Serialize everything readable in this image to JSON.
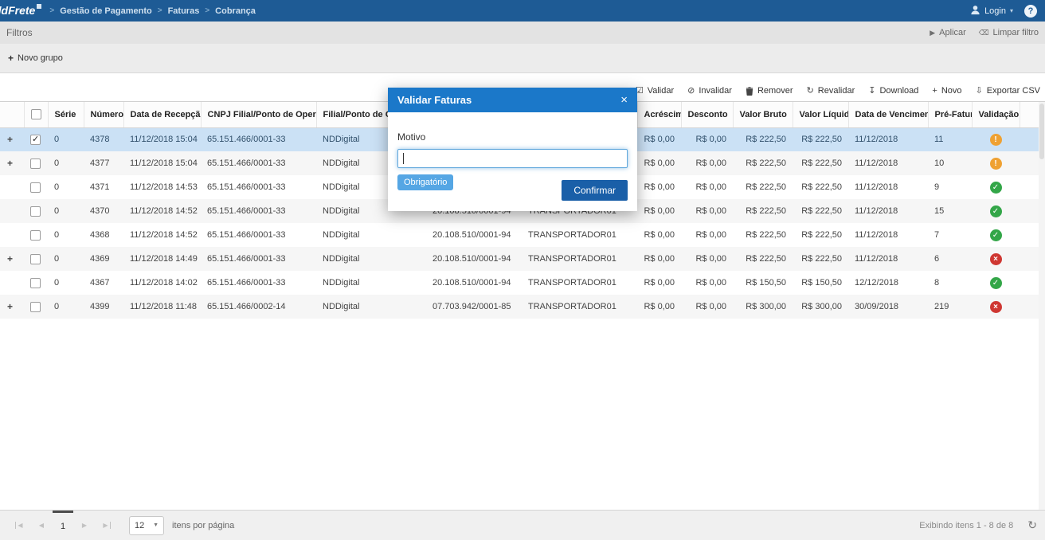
{
  "topbar": {
    "logo": "ddFrete",
    "breadcrumbs": [
      "Gestão de Pagamento",
      "Faturas",
      "Cobrança"
    ],
    "login_label": "Login",
    "help_label": "?"
  },
  "filters": {
    "title": "Filtros",
    "apply_label": "Aplicar",
    "clear_label": "Limpar filtro",
    "new_group_label": "Novo grupo"
  },
  "toolbar": {
    "validate_label": "Validar",
    "invalidate_label": "Invalidar",
    "remove_label": "Remover",
    "revalidate_label": "Revalidar",
    "download_label": "Download",
    "new_label": "Novo",
    "export_csv_label": "Exportar CSV"
  },
  "table": {
    "headers": {
      "serie": "Série",
      "numero": "Número",
      "recepcao": "Data de Recepção",
      "cnpj_filial": "CNPJ Filial/Ponto de Operação",
      "filial": "Filial/Ponto de Operação",
      "cnpj_transp": "",
      "transp": "",
      "acrescimo": "Acréscimo",
      "desconto": "Desconto",
      "bruto": "Valor Bruto",
      "liquido": "Valor Líquido",
      "vencimento": "Data de Vencimento",
      "prefatura": "Pré-Fatura",
      "validacao": "Validação"
    },
    "rows": [
      {
        "expand": true,
        "checked": true,
        "selected": true,
        "serie": "0",
        "numero": "4378",
        "recepcao": "11/12/2018 15:04",
        "cnpj_filial": "65.151.466/0001-33",
        "filial": "NDDigital",
        "cnpj_transp": "",
        "transp": "",
        "acrescimo": "R$ 0,00",
        "desconto": "R$ 0,00",
        "bruto": "R$ 222,50",
        "liquido": "R$ 222,50",
        "vencimento": "11/12/2018",
        "prefatura": "11",
        "validacao": "warning"
      },
      {
        "expand": true,
        "checked": false,
        "selected": false,
        "serie": "0",
        "numero": "4377",
        "recepcao": "11/12/2018 15:04",
        "cnpj_filial": "65.151.466/0001-33",
        "filial": "NDDigital",
        "cnpj_transp": "",
        "transp": "",
        "acrescimo": "R$ 0,00",
        "desconto": "R$ 0,00",
        "bruto": "R$ 222,50",
        "liquido": "R$ 222,50",
        "vencimento": "11/12/2018",
        "prefatura": "10",
        "validacao": "warning"
      },
      {
        "expand": false,
        "checked": false,
        "selected": false,
        "serie": "0",
        "numero": "4371",
        "recepcao": "11/12/2018 14:53",
        "cnpj_filial": "65.151.466/0001-33",
        "filial": "NDDigital",
        "cnpj_transp": "",
        "transp": "",
        "acrescimo": "R$ 0,00",
        "desconto": "R$ 0,00",
        "bruto": "R$ 222,50",
        "liquido": "R$ 222,50",
        "vencimento": "11/12/2018",
        "prefatura": "9",
        "validacao": "ok"
      },
      {
        "expand": false,
        "checked": false,
        "selected": false,
        "serie": "0",
        "numero": "4370",
        "recepcao": "11/12/2018 14:52",
        "cnpj_filial": "65.151.466/0001-33",
        "filial": "NDDigital",
        "cnpj_transp": "20.108.510/0001-94",
        "transp": "TRANSPORTADOR01",
        "acrescimo": "R$ 0,00",
        "desconto": "R$ 0,00",
        "bruto": "R$ 222,50",
        "liquido": "R$ 222,50",
        "vencimento": "11/12/2018",
        "prefatura": "15",
        "validacao": "ok"
      },
      {
        "expand": false,
        "checked": false,
        "selected": false,
        "serie": "0",
        "numero": "4368",
        "recepcao": "11/12/2018 14:52",
        "cnpj_filial": "65.151.466/0001-33",
        "filial": "NDDigital",
        "cnpj_transp": "20.108.510/0001-94",
        "transp": "TRANSPORTADOR01",
        "acrescimo": "R$ 0,00",
        "desconto": "R$ 0,00",
        "bruto": "R$ 222,50",
        "liquido": "R$ 222,50",
        "vencimento": "11/12/2018",
        "prefatura": "7",
        "validacao": "ok"
      },
      {
        "expand": true,
        "checked": false,
        "selected": false,
        "serie": "0",
        "numero": "4369",
        "recepcao": "11/12/2018 14:49",
        "cnpj_filial": "65.151.466/0001-33",
        "filial": "NDDigital",
        "cnpj_transp": "20.108.510/0001-94",
        "transp": "TRANSPORTADOR01",
        "acrescimo": "R$ 0,00",
        "desconto": "R$ 0,00",
        "bruto": "R$ 222,50",
        "liquido": "R$ 222,50",
        "vencimento": "11/12/2018",
        "prefatura": "6",
        "validacao": "error"
      },
      {
        "expand": false,
        "checked": false,
        "selected": false,
        "serie": "0",
        "numero": "4367",
        "recepcao": "11/12/2018 14:02",
        "cnpj_filial": "65.151.466/0001-33",
        "filial": "NDDigital",
        "cnpj_transp": "20.108.510/0001-94",
        "transp": "TRANSPORTADOR01",
        "acrescimo": "R$ 0,00",
        "desconto": "R$ 0,00",
        "bruto": "R$ 150,50",
        "liquido": "R$ 150,50",
        "vencimento": "12/12/2018",
        "prefatura": "8",
        "validacao": "ok"
      },
      {
        "expand": true,
        "checked": false,
        "selected": false,
        "serie": "0",
        "numero": "4399",
        "recepcao": "11/12/2018 11:48",
        "cnpj_filial": "65.151.466/0002-14",
        "filial": "NDDigital",
        "cnpj_transp": "07.703.942/0001-85",
        "transp": "TRANSPORTADOR01",
        "acrescimo": "R$ 0,00",
        "desconto": "R$ 0,00",
        "bruto": "R$ 300,00",
        "liquido": "R$ 300,00",
        "vencimento": "30/09/2018",
        "prefatura": "219",
        "validacao": "error"
      }
    ]
  },
  "modal": {
    "title": "Validar Faturas",
    "motivo_label": "Motivo",
    "input_value": "",
    "required_label": "Obrigatório",
    "confirm_label": "Confirmar"
  },
  "pagination": {
    "current_page": "1",
    "page_size": "12",
    "per_page_label": "itens por página",
    "summary": "Exibindo itens 1 - 8 de 8"
  },
  "icons": {
    "play": "▶",
    "eraser": "⌫",
    "check_square": "☑",
    "slash_circle": "⊘",
    "refresh": "↻",
    "download": "↧",
    "plus": "+",
    "export": "⇩",
    "sort_desc": "↓",
    "chevron_down": "▾",
    "select_arrow": "▼",
    "prev": "◀",
    "next": "▶",
    "close": "×",
    "expand": "+",
    "breadcrumb_sep": ">"
  },
  "validation_icons": {
    "warning": "!",
    "ok": "✓",
    "error": "×"
  },
  "colors": {
    "topbar": "#1e5b95",
    "modal_header": "#1b78c9",
    "confirm_button": "#1a5fa8",
    "selected_row": "#cbe1f5",
    "warning": "#efa132",
    "ok": "#33a648",
    "error": "#cf3732"
  }
}
